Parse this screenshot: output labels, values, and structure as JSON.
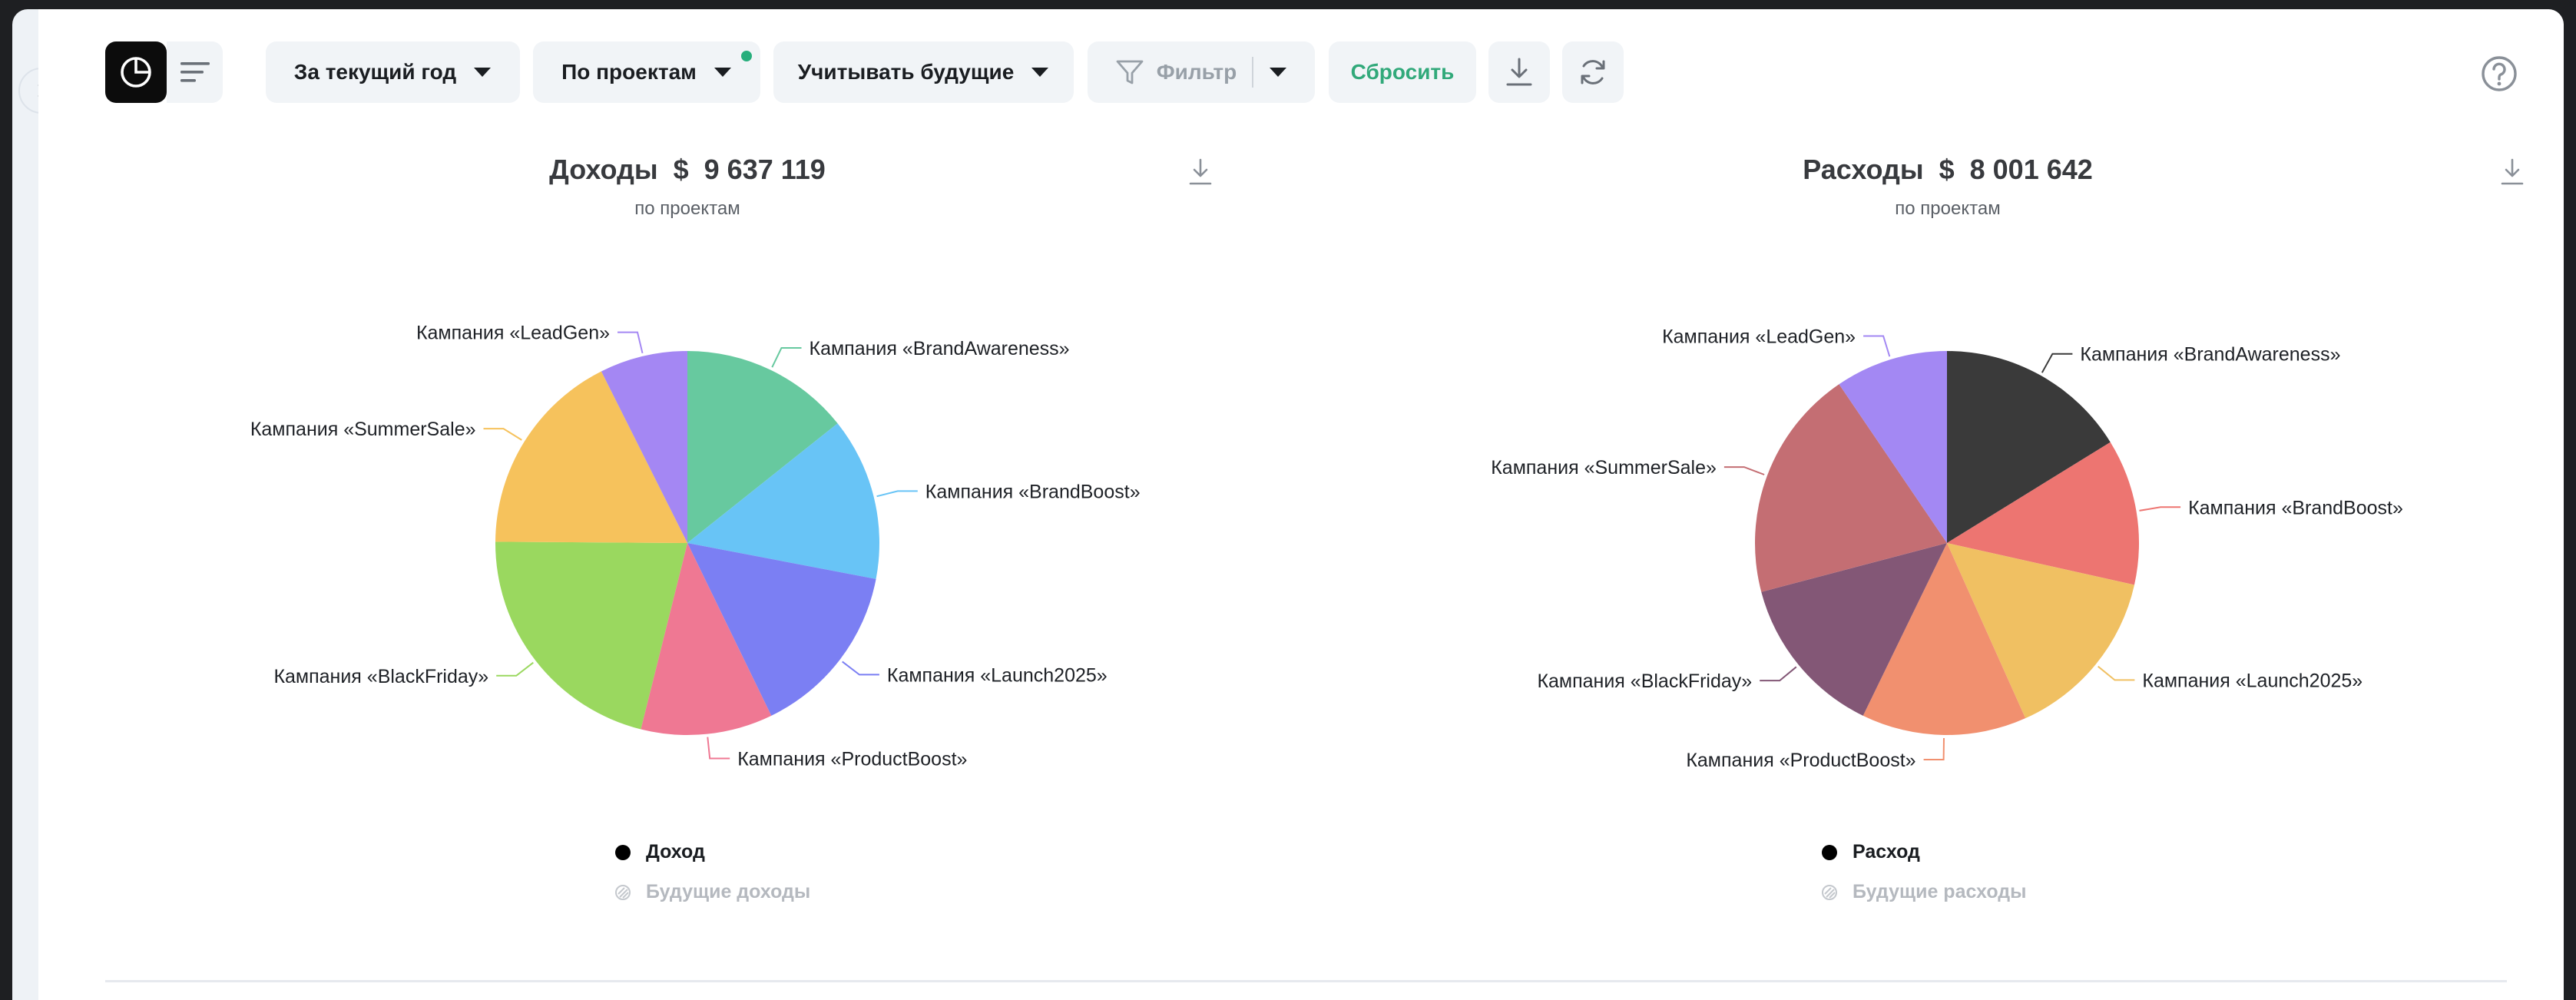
{
  "toolbar": {
    "period_label": "За текущий год",
    "group_label": "По проектам",
    "future_label": "Учитывать будущие",
    "filter_label": "Фильтр",
    "reset_label": "Сбросить"
  },
  "colors": {
    "accent_green": "#31a97a",
    "indicator_dot": "#27ae7c"
  },
  "chart_data": [
    {
      "type": "pie",
      "title": "Доходы",
      "currency": "$",
      "total": "9 637 119",
      "subtitle": "по проектам",
      "legend": [
        {
          "label": "Доход",
          "kind": "solid"
        },
        {
          "label": "Будущие доходы",
          "kind": "hatched"
        }
      ],
      "slices": [
        {
          "label": "Кампания «BrandAwareness»",
          "value": 14.3,
          "color": "#67c99f"
        },
        {
          "label": "Кампания «BrandBoost»",
          "value": 13.7,
          "color": "#68c4f6"
        },
        {
          "label": "Кампания «Launch2025»",
          "value": 14.8,
          "color": "#7b7ff3"
        },
        {
          "label": "Кампания «ProductBoost»",
          "value": 11.1,
          "color": "#ef7893"
        },
        {
          "label": "Кампания «BlackFriday»",
          "value": 21.2,
          "color": "#9ad85f"
        },
        {
          "label": "Кампания «SummerSale»",
          "value": 17.5,
          "color": "#f6c25c"
        },
        {
          "label": "Кампания «LeadGen»",
          "value": 7.4,
          "color": "#a487f3"
        }
      ]
    },
    {
      "type": "pie",
      "title": "Расходы",
      "currency": "$",
      "total": "8 001 642",
      "subtitle": "по проектам",
      "legend": [
        {
          "label": "Расход",
          "kind": "solid"
        },
        {
          "label": "Будущие расходы",
          "kind": "hatched"
        }
      ],
      "slices": [
        {
          "label": "Кампания «BrandAwareness»",
          "value": 16.2,
          "color": "#3a3a3a"
        },
        {
          "label": "Кампания «BrandBoost»",
          "value": 12.3,
          "color": "#ed7571"
        },
        {
          "label": "Кампания «Launch2025»",
          "value": 14.8,
          "color": "#f0c062"
        },
        {
          "label": "Кампания «ProductBoost»",
          "value": 13.9,
          "color": "#f1906f"
        },
        {
          "label": "Кампания «BlackFriday»",
          "value": 13.7,
          "color": "#835776"
        },
        {
          "label": "Кампания «SummerSale»",
          "value": 19.6,
          "color": "#c46e73"
        },
        {
          "label": "Кампания «LeadGen»",
          "value": 9.5,
          "color": "#a388f3"
        }
      ]
    }
  ]
}
